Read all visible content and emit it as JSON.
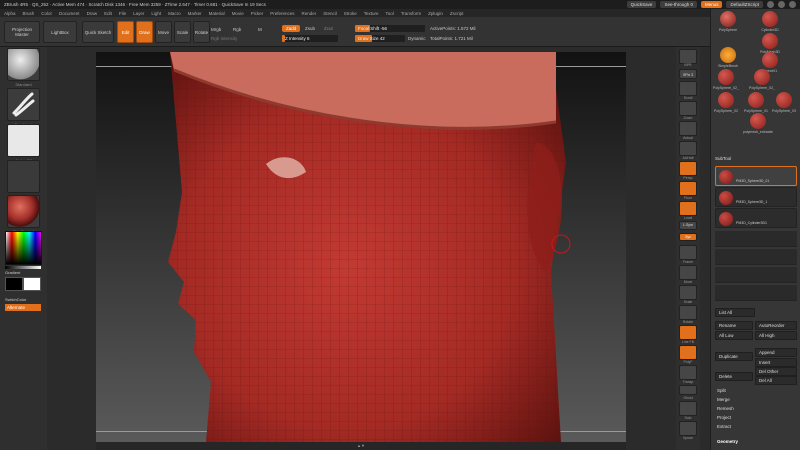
{
  "titlebar": {
    "title": "ZBrush 4R5 · QS_252 · Active Mem 474 · Scratch Disk 1346 · Free Mem 3259 · ZTime 2.647 · Timer 0.681 · QuickSave In 19 Secs",
    "quicksave": "QuickSave",
    "see_through": "See-through 0",
    "menus_btn": "Menus",
    "script_btn": "DefaultZScript"
  },
  "menubar": [
    "Alpha",
    "Brush",
    "Color",
    "Document",
    "Draw",
    "Edit",
    "File",
    "Layer",
    "Light",
    "Macro",
    "Marker",
    "Material",
    "Movie",
    "Picker",
    "Preferences",
    "Render",
    "Stencil",
    "Stroke",
    "Texture",
    "Tool",
    "Transform",
    "Zplugin",
    "Zscript"
  ],
  "shelf": {
    "projection_master": "Projection Master",
    "lightbox": "LightBox",
    "quick_sketch": "Quick Sketch",
    "edit": "Edit",
    "draw": "Draw",
    "move": "Move",
    "scale": "Scale",
    "rotate": "Rotate",
    "mrgb": "Mrgb",
    "rgb": "Rgb",
    "m": "M",
    "rgb_intensity": "Rgb Intensity",
    "zadd": "Zadd",
    "zsub": "Zsub",
    "zcut": "Zcut",
    "z_intensity": "Z Intensity 6",
    "focal_shift": "Focal Shift -56",
    "draw_size": "Draw Size 42",
    "dynamic": "Dynamic",
    "active_points": "ActivePoints: 1.572 Mil",
    "total_points": "TotalPoints: 1.721 Mil",
    "focal_shift_level": 0.22,
    "draw_size_level": 0.33,
    "z_intensity_level": 0.06
  },
  "lefttray": {
    "brush": "Standard",
    "stroke": "FreeHand",
    "alpha": "Alpha Off",
    "texture": "Texture Off",
    "material": "SkinShade4",
    "gradient": "Gradient",
    "switch_color": "SwitchColor",
    "alternate": "Alternate"
  },
  "righttray": [
    "BPR",
    "SPix 3",
    "Scroll",
    "Zoom",
    "Actual",
    "AAHalf",
    "Persp",
    "Floor",
    "Local",
    "L.Sym",
    "Xyz",
    "Frame",
    "Move",
    "Scale",
    "Rotate",
    "Line Fill",
    "PolyF",
    "Transp",
    "Ghost",
    "Solo",
    "Xpose"
  ],
  "tools": {
    "items": [
      {
        "name": "PolySphere"
      },
      {
        "name": "Cylinder3D"
      },
      {
        "name": "PolyMesh3D"
      },
      {
        "name": "SimpleBrush"
      },
      {
        "name": "Fleece01"
      },
      {
        "name": "PolySphere_02_u"
      },
      {
        "name": "PolySphere_02_u"
      },
      {
        "name": "PolySphere_02"
      },
      {
        "name": "PolySphere_01"
      },
      {
        "name": "PolySphere_03"
      },
      {
        "name": "polymesh_extracted"
      }
    ]
  },
  "subtool": {
    "header": "SubTool",
    "rows": [
      {
        "name": "PM3D_Sphere3D_01"
      },
      {
        "name": "PM3D_Sphere3D_1"
      },
      {
        "name": "PM3D_Cylinder3D1"
      }
    ],
    "list_all": "List All",
    "rename": "Rename",
    "auto_reorder": "AutoReorder",
    "all_low": "All Low",
    "all_high": "All High",
    "duplicate": "Duplicate",
    "append": "Append",
    "insert": "Insert",
    "delete": "Delete",
    "del_other": "Del Other",
    "del_all": "Del All",
    "split": "Split",
    "merge": "Merge",
    "remesh": "Remesh",
    "project": "Project",
    "extract": "Extract",
    "geometry": "Geometry"
  },
  "colors": {
    "accent": "#e0701c",
    "skin": "#b8312c"
  }
}
